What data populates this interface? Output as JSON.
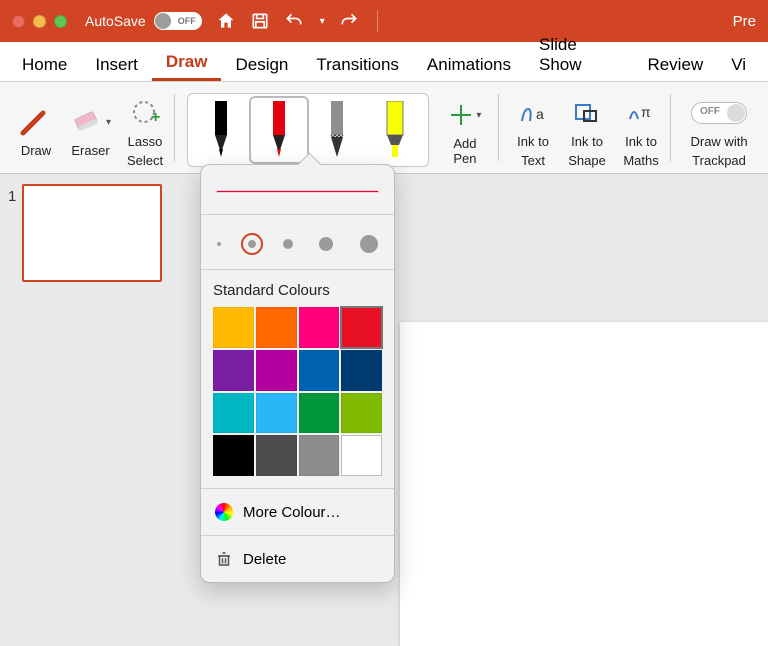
{
  "titlebar": {
    "autosave_label": "AutoSave",
    "autosave_state": "OFF",
    "app_right": "Pre"
  },
  "tabs": [
    {
      "label": "Home",
      "active": false
    },
    {
      "label": "Insert",
      "active": false
    },
    {
      "label": "Draw",
      "active": true
    },
    {
      "label": "Design",
      "active": false
    },
    {
      "label": "Transitions",
      "active": false
    },
    {
      "label": "Animations",
      "active": false
    },
    {
      "label": "Slide Show",
      "active": false
    },
    {
      "label": "Review",
      "active": false
    },
    {
      "label": "Vi",
      "active": false
    }
  ],
  "ribbon": {
    "draw": "Draw",
    "eraser": "Eraser",
    "lasso1": "Lasso",
    "lasso2": "Select",
    "pens": [
      {
        "color": "#000000",
        "type": "pen"
      },
      {
        "color": "#e3000f",
        "type": "pen",
        "selected": true
      },
      {
        "color": "#8f8f8f",
        "type": "pencil"
      },
      {
        "color": "#f7ff00",
        "type": "highlighter"
      }
    ],
    "add_pen": "Add Pen",
    "ink_text1": "Ink to",
    "ink_text2": "Text",
    "ink_shape1": "Ink to",
    "ink_shape2": "Shape",
    "ink_math1": "Ink to",
    "ink_math2": "Maths",
    "trackpad1": "Draw with",
    "trackpad2": "Trackpad",
    "toggle_state": "OFF"
  },
  "thumbs": {
    "first_num": "1"
  },
  "popup": {
    "thickness_levels": [
      4,
      8,
      10,
      14,
      18
    ],
    "thickness_selected_index": 1,
    "standard_title": "Standard Colours",
    "swatches": [
      "#ffb900",
      "#ff6a00",
      "#ff007a",
      "#e81123",
      "#7a1fa2",
      "#b4009e",
      "#0063b1",
      "#003a70",
      "#00b7c3",
      "#29b6f6",
      "#00973a",
      "#7fba00",
      "#000000",
      "#4d4d4d",
      "#8c8c8c",
      "#ffffff"
    ],
    "swatch_selected_index": 3,
    "swatch_cols": 5,
    "swatches5": [
      "#ffb900",
      "#ff6a00",
      "#ff007a",
      "#e81123",
      "#e81123",
      "#7a1fa2",
      "#b4009e",
      "#b4009e",
      "#0063b1",
      "#003a70",
      "#00b7c3",
      "#29b6f6",
      "#29b6f6",
      "#00973a",
      "#7fba00",
      "#000000",
      "#4d4d4d",
      "#8c8c8c",
      "#8c8c8c",
      "#ffffff"
    ],
    "_note": "using 4-col grid matching visual; swatches array of 16 used",
    "more_colours": "More Colour…",
    "delete": "Delete"
  }
}
